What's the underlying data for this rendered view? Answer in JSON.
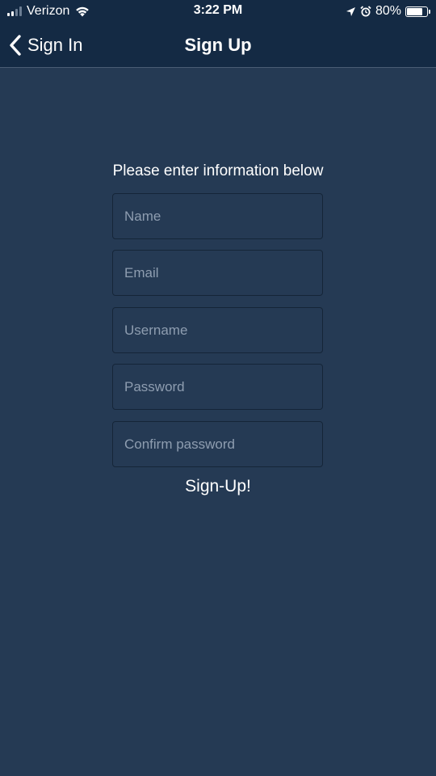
{
  "status_bar": {
    "carrier": "Verizon",
    "time": "3:22 PM",
    "battery_text": "80%",
    "battery_level": 0.8,
    "icons": [
      "signal-icon",
      "wifi-icon",
      "location-arrow-icon",
      "alarm-icon",
      "battery-icon"
    ]
  },
  "nav": {
    "back_label": "Sign In",
    "title": "Sign Up"
  },
  "form": {
    "instructions": "Please enter information below",
    "fields": [
      {
        "placeholder": "Name",
        "value": ""
      },
      {
        "placeholder": "Email",
        "value": ""
      },
      {
        "placeholder": "Username",
        "value": ""
      },
      {
        "placeholder": "Password",
        "value": ""
      },
      {
        "placeholder": "Confirm password",
        "value": ""
      }
    ],
    "submit_label": "Sign-Up!"
  },
  "colors": {
    "background": "#253a54",
    "navbar": "#142a44",
    "field_border": "#152538",
    "placeholder": "#8e9db0",
    "text": "#ffffff"
  }
}
